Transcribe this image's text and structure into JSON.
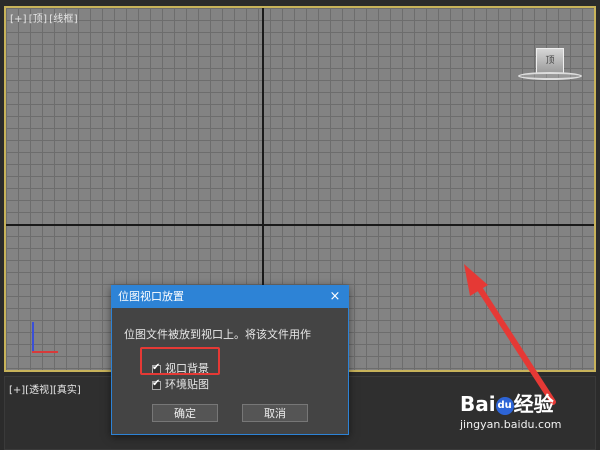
{
  "top_viewport": {
    "label_parts": [
      "[+]",
      "[顶]",
      "[线框]"
    ],
    "viewcube_label": "顶"
  },
  "bottom_viewport": {
    "label_parts": [
      "[+]",
      "[透视]",
      "[真实]"
    ]
  },
  "dialog": {
    "title": "位图视口放置",
    "close_glyph": "×",
    "message": "位图文件被放到视口上。将该文件用作",
    "checkbox_1_label": "视口背景",
    "checkbox_1_checked": true,
    "checkbox_2_label": "环境贴图",
    "checkbox_2_checked": true,
    "ok_label": "确定",
    "cancel_label": "取消"
  },
  "watermark": {
    "logo_text_1": "Bai",
    "logo_paw": "du",
    "logo_text_2": "经验",
    "url": "jingyan.baidu.com"
  },
  "colors": {
    "dialog_title_bg": "#2d83d6",
    "highlight": "#e53935",
    "viewport_border": "#c8b35a"
  }
}
